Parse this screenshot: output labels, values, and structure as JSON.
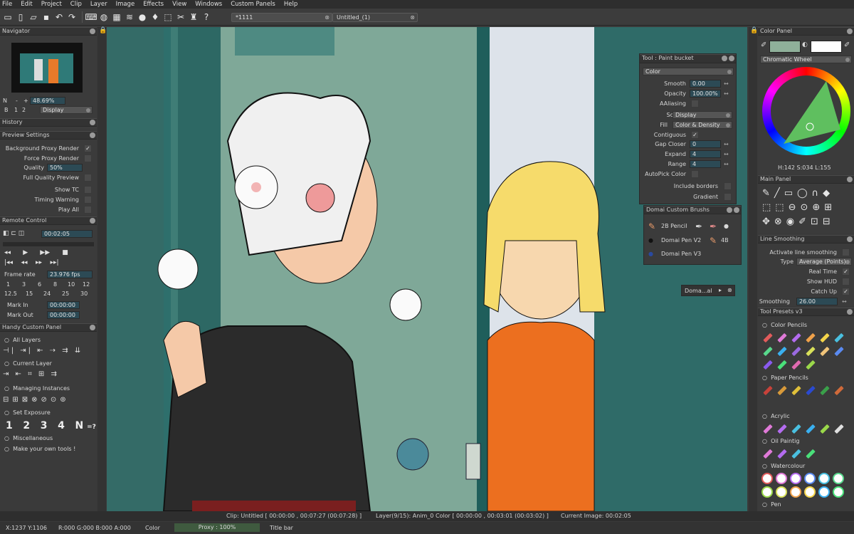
{
  "menu": [
    "File",
    "Edit",
    "Project",
    "Clip",
    "Layer",
    "Image",
    "Effects",
    "View",
    "Windows",
    "Custom Panels",
    "Help"
  ],
  "tabs": [
    {
      "label": "*1111"
    },
    {
      "label": "Untitled_(1)"
    }
  ],
  "navigator": {
    "title": "Navigator",
    "zoom": "48.69%",
    "mode": "Display",
    "n_label": "N",
    "plus": "+",
    "minus": "-",
    "nums": [
      "B",
      "1",
      "2"
    ]
  },
  "history": {
    "title": "History"
  },
  "preview": {
    "title": "Preview Settings",
    "background_proxy_render": "Background Proxy Render",
    "force_proxy_render": "Force Proxy Render",
    "quality_label": "Quality",
    "quality_value": "50%",
    "full_quality_preview": "Full Quality Preview",
    "show_tc": "Show TC",
    "timing_warning": "Timing Warning",
    "play_all": "Play All"
  },
  "remote": {
    "title": "Remote Control",
    "timecode": "00:02:05",
    "frame_rate_label": "Frame rate",
    "frame_rate": "23.976 fps",
    "rates_row1": [
      "1",
      "3",
      "6",
      "8",
      "10",
      "12"
    ],
    "rates_row2": [
      "12.5",
      "15",
      "24",
      "25",
      "30"
    ],
    "mark_in_label": "Mark In",
    "mark_in": "00:00:00",
    "mark_out_label": "Mark Out",
    "mark_out": "00:00:00"
  },
  "handy": {
    "title": "Handy Custom Panel",
    "sections": [
      "All Layers",
      "Current Layer",
      "Managing Instances",
      "Set Exposure",
      "Miscellaneous",
      "Make your own tools !"
    ],
    "exposure": [
      "1",
      "2",
      "3",
      "4",
      "N",
      "=?"
    ]
  },
  "tool_paint": {
    "title": "Tool : Paint bucket",
    "mode": "Color",
    "smooth_label": "Smooth",
    "smooth": "0.00",
    "opacity_label": "Opacity",
    "opacity": "100.00%",
    "aaliasing_label": "AAliasing",
    "source_label": "Source",
    "source": "Display",
    "fill_label": "Fill",
    "fill": "Color & Density",
    "contiguous_label": "Contiguous",
    "gap_label": "Gap Closer",
    "gap": "0",
    "expand_label": "Expand",
    "expand": "4",
    "range_label": "Range",
    "range": "4",
    "autopick_label": "AutoPick Color",
    "include_borders": "Include borders",
    "gradient": "Gradient"
  },
  "domai": {
    "title": "Domai Custom Brushs",
    "b1": "2B Pencil",
    "b2": "Domai Pen V2",
    "b3": "4B",
    "b4": "Domai Pen V3",
    "mini": "Doma...al"
  },
  "color_panel": {
    "title": "Color Panel",
    "wheel": "Chromatic Wheel",
    "hsl": "H:142 S:034 L:155",
    "fg": "#8fb09a",
    "bg": "#ffffff"
  },
  "main_panel": {
    "title": "Main Panel"
  },
  "line_smoothing": {
    "title": "Line Smoothing",
    "activate": "Activate line smoothing",
    "type_label": "Type",
    "type": "Average (Points)",
    "real_time": "Real Time",
    "show_hud": "Show HUD",
    "catch_up": "Catch Up",
    "smoothing_label": "Smoothing",
    "smoothing": "26.00"
  },
  "presets": {
    "title": "Tool Presets v3",
    "groups": [
      "Color Pencils",
      "Paper Pencils",
      "Acrylic",
      "Oil Paintig",
      "Watercolour",
      "Pen"
    ]
  },
  "status": {
    "clip": "Clip: Untitled [ 00:00:00 , 00:07:27  (00:07:28) ]",
    "layer": "Layer(9/15): Anim_0 Color [ 00:00:00 , 00:03:01  (00:03:02) ]",
    "current_image": "Current Image: 00:02:05",
    "coords": "X:1237  Y:1106",
    "rgba": "R:000 G:000 B:000 A:000",
    "color": "Color",
    "proxy": "Proxy : 100%",
    "titlebar": "Title bar"
  }
}
